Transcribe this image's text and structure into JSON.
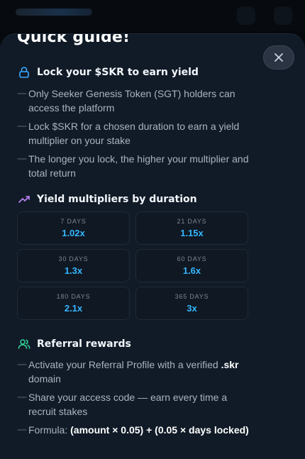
{
  "guide": {
    "title": "Quick guide!"
  },
  "sections": {
    "lock": {
      "title": "Lock your $SKR to earn yield",
      "bullets": [
        "Only Seeker Genesis Token (SGT) holders can access the platform",
        "Lock $SKR for a chosen duration to earn a yield multiplier on your stake",
        "The longer you lock, the higher your multiplier and total return"
      ]
    },
    "yield": {
      "title": "Yield multipliers by duration",
      "cards": [
        {
          "days": "7 DAYS",
          "multiplier": "1.02x"
        },
        {
          "days": "21 DAYS",
          "multiplier": "1.15x"
        },
        {
          "days": "30 DAYS",
          "multiplier": "1.3x"
        },
        {
          "days": "60 DAYS",
          "multiplier": "1.6x"
        },
        {
          "days": "180 DAYS",
          "multiplier": "2.1x"
        },
        {
          "days": "365 DAYS",
          "multiplier": "3x"
        }
      ]
    },
    "referral": {
      "title": "Referral rewards",
      "bullet1_pre": "Activate your Referral Profile with a verified",
      "bullet1_bold": ".skr",
      "bullet1_post": "domain",
      "bullet2": "Share your access code — earn every time a recruit stakes",
      "bullet3_pre": "Formula:",
      "bullet3_bold": "(amount × 0.05) + (0.05 × days locked)"
    }
  },
  "colors": {
    "accent": "#36b7ff",
    "lock_icon": "#3aa8ff",
    "trend_icon": "#c084fc",
    "users_icon": "#34d399",
    "sheet_bg": "#111b27"
  },
  "icons": {
    "close": "close-icon",
    "lock": "lock-icon",
    "trend": "trending-up-icon",
    "referral": "users-icon"
  }
}
